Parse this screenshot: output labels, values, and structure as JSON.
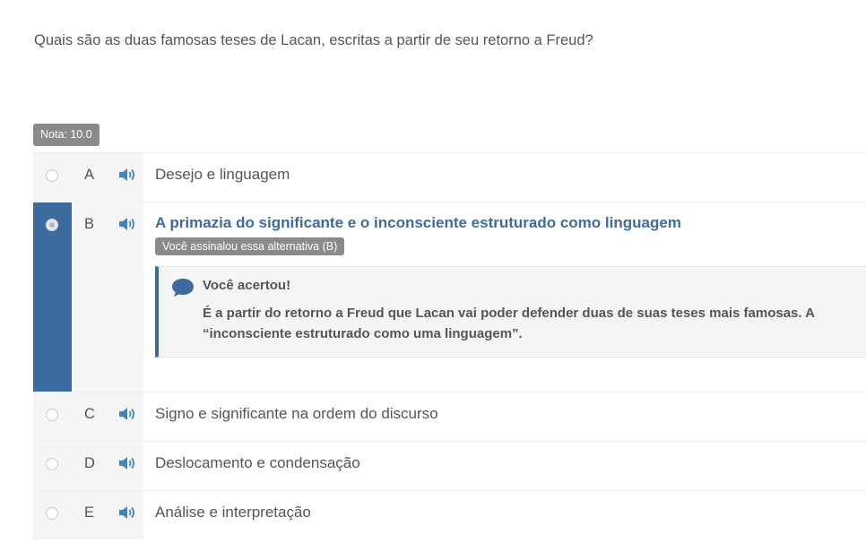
{
  "question": {
    "text": "Quais são as duas famosas teses de Lacan, escritas a partir de seu retorno a Freud?"
  },
  "grade_badge": "Nota: 10.0",
  "options": [
    {
      "letter": "A",
      "text": "Desejo e linguagem",
      "selected": false
    },
    {
      "letter": "B",
      "text": "A primazia do significante e o inconsciente estruturado como linguagem",
      "selected": true,
      "marked_label": "Você assinalou essa alternativa (B)",
      "feedback": {
        "title": "Você acertou!",
        "line1": "É a partir do retorno a Freud que Lacan vai poder defender duas de suas teses mais famosas. A",
        "line2": "“inconsciente estruturado como uma linguagem”."
      }
    },
    {
      "letter": "C",
      "text": "Signo e significante na ordem do discurso",
      "selected": false
    },
    {
      "letter": "D",
      "text": "Deslocamento e condensação",
      "selected": false
    },
    {
      "letter": "E",
      "text": "Análise e interpretação",
      "selected": false
    }
  ],
  "icons": {
    "audio": "speaker-icon",
    "feedback": "chat-bubble-icon"
  },
  "colors": {
    "accent": "#3d6ba0",
    "badge": "#8a8a8a",
    "text": "#555555",
    "audio": "#3a87c4"
  }
}
